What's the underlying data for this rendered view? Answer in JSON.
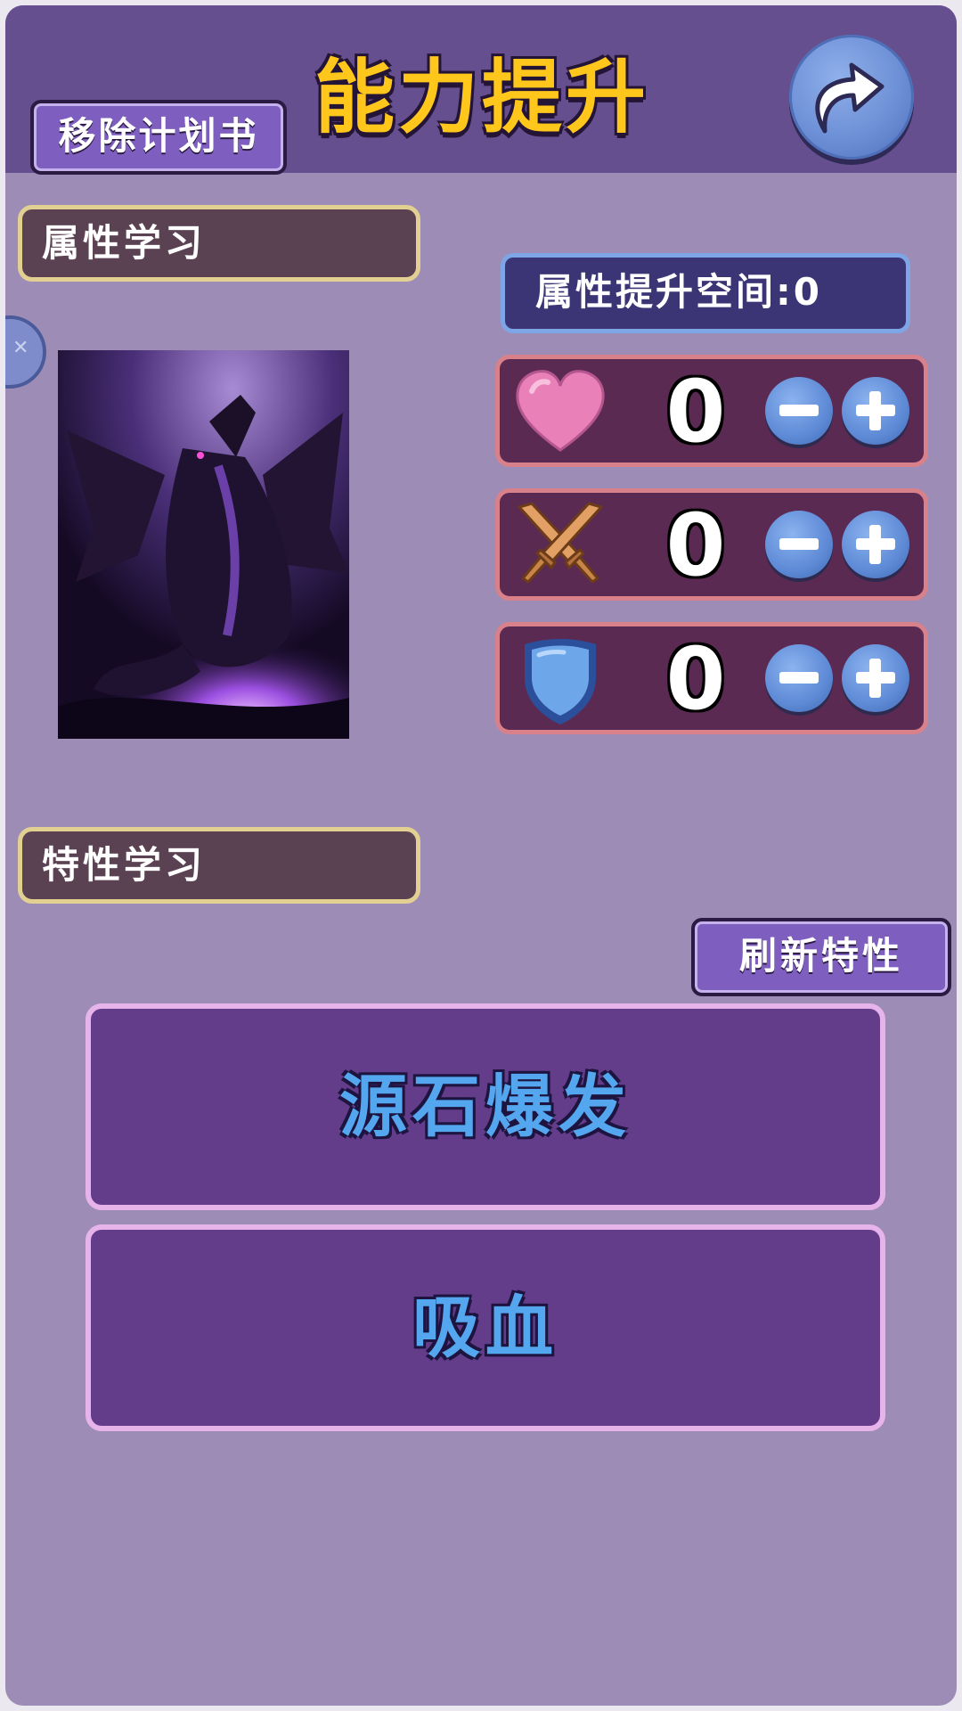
{
  "header": {
    "title": "能力提升",
    "remove_button": "移除计划书"
  },
  "attribute_section": {
    "label": "属性学习",
    "space_label": "属性提升空间:0"
  },
  "stats": [
    {
      "icon": "heart-icon",
      "value": "0"
    },
    {
      "icon": "sword-icon",
      "value": "0"
    },
    {
      "icon": "shield-icon",
      "value": "0"
    }
  ],
  "trait_section": {
    "label": "特性学习",
    "refresh_button": "刷新特性"
  },
  "traits": [
    {
      "name": "源石爆发"
    },
    {
      "name": "吸血"
    }
  ],
  "colors": {
    "title": "#ffc61c",
    "trait_text": "#54a6ef",
    "panel": "#9d8db6",
    "header": "#664f8f"
  }
}
